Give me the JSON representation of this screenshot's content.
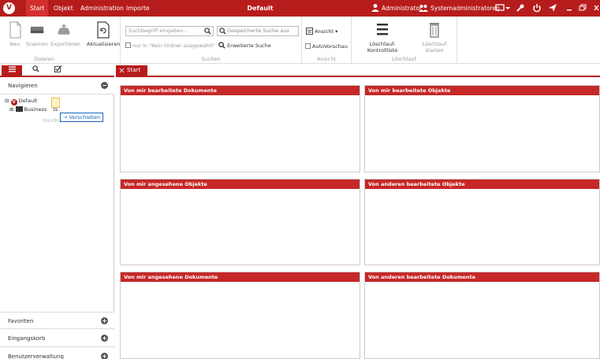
{
  "app": {
    "logo_letter": "V",
    "menu": [
      "Start",
      "Objekt",
      "Administration",
      "Importe"
    ],
    "title": "Default",
    "user": "Administrator",
    "group": "Systemadministratoren"
  },
  "ribbon": {
    "dateien": {
      "label": "Dateien",
      "buttons": [
        "Neu",
        "Scannen",
        "Exportieren",
        "Aktualisieren"
      ]
    },
    "suchen": {
      "label": "Suchen",
      "search_placeholder": "Suchbegriff eingeben...",
      "only_in_folder": "nur in \"Kein Ordner ausgewählt\"",
      "saved_search": "Gespeicherte Suche aus",
      "extended_search": "Erweiterte Suche"
    },
    "ansicht": {
      "label": "Ansicht",
      "view_button": "Ansicht",
      "autopreview": "AutoVorschau"
    },
    "loeschlauf": {
      "label": "Löschlauf",
      "control_list": "Löschlauf-Kontrollliste",
      "start": "Löschlauf starten"
    }
  },
  "left_panel": {
    "sections": {
      "navigate": "Navigieren",
      "favorites": "Favoriten",
      "inbox": "Eingangskorb",
      "user_admin": "Benutzerverwaltung"
    },
    "tree": {
      "root": "Default",
      "child": "Business",
      "child_suffix": "ts"
    },
    "drag_ghost": "Handbücher",
    "drag_tooltip": "Verschieben"
  },
  "main": {
    "tab": "Start",
    "panels": [
      "Von mir bearbeitete Dokumente",
      "Von mir bearbeitete Objekte",
      "Von mir angesehene Objekte",
      "Von anderen bearbeitete Objekte",
      "Von mir angesehene Dokumente",
      "Von anderen bearbeitete Dokumente"
    ]
  },
  "colors": {
    "accent": "#b71c1c",
    "header": "#c62828"
  }
}
